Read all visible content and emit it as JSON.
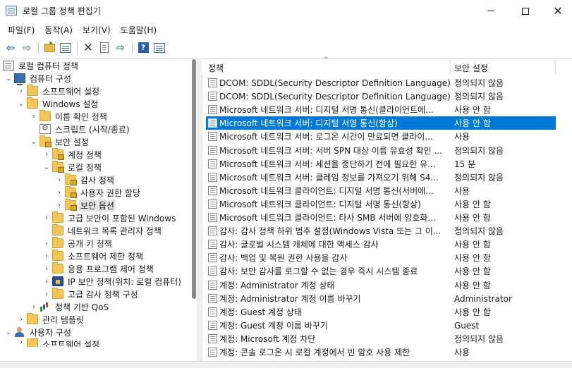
{
  "window": {
    "title": "로컬 그룹 정책 편집기",
    "close_glyph": "✕"
  },
  "menu": [
    "파일(F)",
    "동작(A)",
    "보기(V)",
    "도움말(H)"
  ],
  "toolbar": {
    "back_glyph": "⇦",
    "forward_glyph": "⇨",
    "delete_glyph": "✕",
    "export_glyph": "⇨",
    "help_glyph": "?"
  },
  "tree": {
    "root": "로컬 컴퓨터 정책",
    "computer_config": "컴퓨터 구성",
    "software_settings": "소프트웨어 설정",
    "windows_settings": "Windows 설정",
    "name_resolution_policy": "이름 확인 정책",
    "scripts": "스크립트 (시작/종료)",
    "security_settings": "보안 설정",
    "account_policies": "계정 정책",
    "local_policies": "로컬 정책",
    "audit_policy": "감사 정책",
    "user_rights": "사용자 권한 할당",
    "security_options": "보안 옵션",
    "advanced_firewall": "고급 보안이 포함된 Windows",
    "network_list": "네트워크 목록 관리자 정책",
    "public_key": "공개 키 정책",
    "software_restriction": "소프트웨어 제한 정책",
    "app_control": "응용 프로그램 제어 정책",
    "ipsec": "IP 보안 정책(위치: 로컬 컴퓨터)",
    "advanced_audit": "고급 감사 정책 구성",
    "qos": "정책 기반 QoS",
    "admin_templates": "관리 템플릿",
    "user_config": "사용자 구성",
    "user_software_settings": "소프트웨어 설정",
    "expanded_glyph": "⌄",
    "collapsed_glyph": "›"
  },
  "list": {
    "col_policy": "정책",
    "col_setting": "보안 설정",
    "sort_glyph": "^",
    "rows": [
      {
        "policy": "DCOM: SDDL(Security Descriptor Definition Language) 구...",
        "setting": "정의되지 않음"
      },
      {
        "policy": "DCOM: SDDL(Security Descriptor Definition Language) 구...",
        "setting": "정의되지 않음"
      },
      {
        "policy": "Microsoft 네트워크 서버: 디지털 서명 통신(클라이언트에...",
        "setting": "사용 안 함"
      },
      {
        "policy": "Microsoft 네트워크 서버: 디지털 서명 통신(항상)",
        "setting": "사용 안 함"
      },
      {
        "policy": "Microsoft 네트워크 서버: 로그온 시간이 만료되면 클라이...",
        "setting": "사용"
      },
      {
        "policy": "Microsoft 네트워크 서버: 서버 SPN 대상 이름 유효성 확인 ...",
        "setting": "정의되지 않음"
      },
      {
        "policy": "Microsoft 네트워크 서버: 세션을 중단하기 전에 필요한 유...",
        "setting": "15 분"
      },
      {
        "policy": "Microsoft 네트워크 서버: 클레임 정보를 가져오기 위해 S4...",
        "setting": "정의되지 않음"
      },
      {
        "policy": "Microsoft 네트워크 클라이언트: 디지털 서명 통신(서버에...",
        "setting": "사용"
      },
      {
        "policy": "Microsoft 네트워크 클라이언트: 디지털 서명 통신(항상)",
        "setting": "사용 안 함"
      },
      {
        "policy": "Microsoft 네트워크 클라이언트: 타사 SMB 서버에 암호화...",
        "setting": "사용 안 함"
      },
      {
        "policy": "감사: 감사 정책 하위 범주 설정(Windows Vista 또는 그 이...",
        "setting": "정의되지 않음"
      },
      {
        "policy": "감사: 글로벌 시스템 개체에 대한 액세스 감사",
        "setting": "사용 안 함"
      },
      {
        "policy": "감사: 백업 및 복원 권한 사용을 감사",
        "setting": "사용 안 함"
      },
      {
        "policy": "감사: 보안 감사를 로그할 수 없는 경우 즉시 시스템 종료",
        "setting": "사용 안 함"
      },
      {
        "policy": "계정: Administrator 계정 상태",
        "setting": "사용 안 함"
      },
      {
        "policy": "계정: Administrator 계정 이름 바꾸기",
        "setting": "Administrator"
      },
      {
        "policy": "계정: Guest 계정 상태",
        "setting": "사용 안 함"
      },
      {
        "policy": "계정: Guest 계정 이름 바꾸기",
        "setting": "Guest"
      },
      {
        "policy": "계정: Microsoft 계정 차단",
        "setting": "정의되지 않음"
      },
      {
        "policy": "계정: 콘솔 로그온 시 로컬 계정에서 빈 암호 사용 제한",
        "setting": "사용"
      }
    ]
  }
}
